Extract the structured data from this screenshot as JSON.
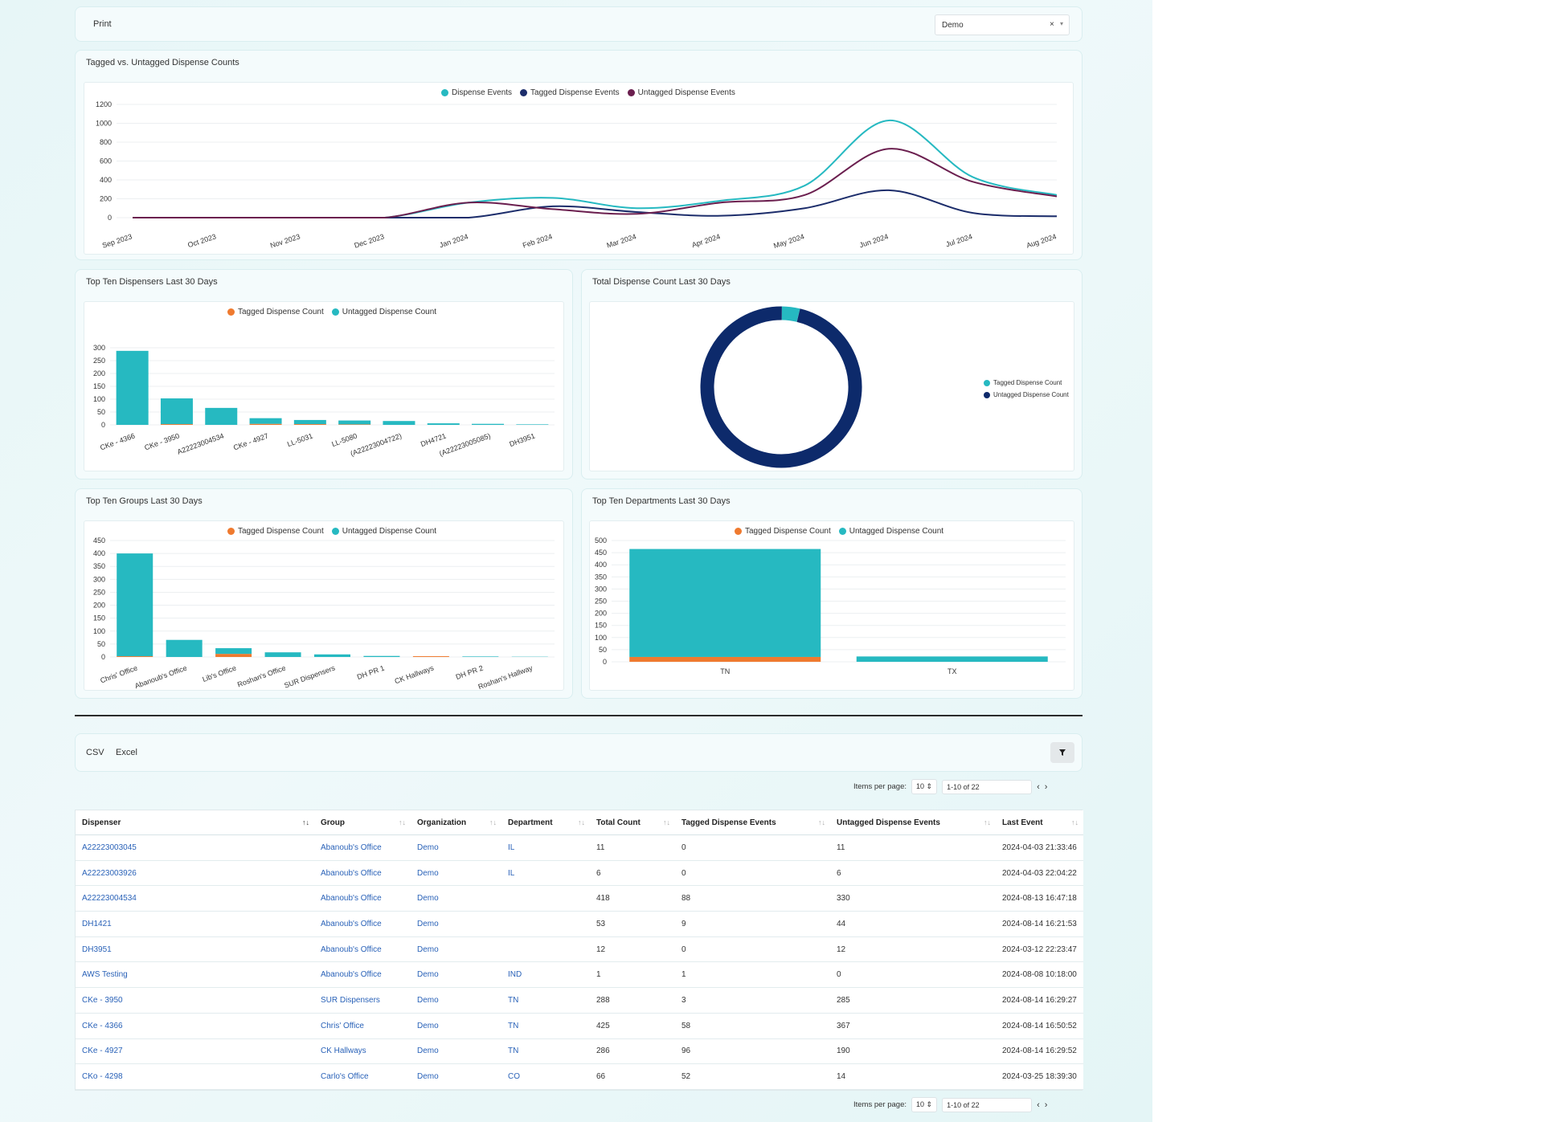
{
  "toolbar": {
    "print_label": "Print",
    "org_select_value": "Demo",
    "clear": "×",
    "caret": "▾"
  },
  "colors": {
    "teal": "#26b9c1",
    "navy": "#1c2d6b",
    "maroon": "#6b1f4f",
    "orange": "#ef7a2f",
    "donut_navy": "#0d2a6b"
  },
  "line_card": {
    "title": "Tagged vs. Untagged Dispense Counts",
    "legend": [
      "Dispense Events",
      "Tagged Dispense Events",
      "Untagged Dispense Events"
    ]
  },
  "dispensers_card": {
    "title": "Top Ten Dispensers Last 30 Days",
    "legend": [
      "Tagged Dispense Count",
      "Untagged Dispense Count"
    ]
  },
  "donut_card": {
    "title": "Total Dispense Count Last 30 Days",
    "legend": [
      "Tagged Dispense Count",
      "Untagged Dispense Count"
    ]
  },
  "groups_card": {
    "title": "Top Ten Groups Last 30 Days",
    "legend": [
      "Tagged Dispense Count",
      "Untagged Dispense Count"
    ]
  },
  "departments_card": {
    "title": "Top Ten Departments Last 30 Days",
    "legend": [
      "Tagged Dispense Count",
      "Untagged Dispense Count"
    ]
  },
  "chart_data": [
    {
      "type": "line",
      "title": "Tagged vs. Untagged Dispense Counts",
      "x": [
        "Sep 2023",
        "Oct 2023",
        "Nov 2023",
        "Dec 2023",
        "Jan 2024",
        "Feb 2024",
        "Mar 2024",
        "Apr 2024",
        "May 2024",
        "Jun 2024",
        "Jul 2024",
        "Aug 2024"
      ],
      "ylim": [
        0,
        1200
      ],
      "yticks": [
        0,
        200,
        400,
        600,
        800,
        1000,
        1200
      ],
      "legend_position": "top",
      "series": [
        {
          "name": "Dispense Events",
          "values": [
            0,
            0,
            0,
            0,
            160,
            210,
            100,
            180,
            340,
            1030,
            430,
            240
          ]
        },
        {
          "name": "Tagged Dispense Events",
          "values": [
            0,
            0,
            0,
            0,
            0,
            120,
            60,
            20,
            100,
            290,
            50,
            15
          ]
        },
        {
          "name": "Untagged Dispense Events",
          "values": [
            0,
            0,
            0,
            0,
            160,
            90,
            40,
            160,
            240,
            730,
            380,
            225
          ]
        }
      ]
    },
    {
      "type": "bar",
      "title": "Top Ten Dispensers Last 30 Days",
      "categories": [
        "CKe - 4366",
        "CKe - 3950",
        "A22223004534",
        "CKe - 4927",
        "LL-5031",
        "LL-5080",
        "(A22223004722)",
        "DH4721",
        "(A22223005085)",
        "DH3951"
      ],
      "ylim": [
        0,
        300
      ],
      "yticks": [
        0,
        50,
        100,
        150,
        200,
        250,
        300
      ],
      "legend_position": "top",
      "stacked": true,
      "series": [
        {
          "name": "Tagged Dispense Count",
          "values": [
            0,
            3,
            0,
            4,
            3,
            2,
            0,
            0,
            0,
            0
          ]
        },
        {
          "name": "Untagged Dispense Count",
          "values": [
            288,
            100,
            66,
            22,
            16,
            15,
            15,
            6,
            4,
            2
          ]
        }
      ]
    },
    {
      "type": "pie",
      "title": "Total Dispense Count Last 30 Days",
      "legend_position": "right",
      "series": [
        {
          "name": "Tagged Dispense Count",
          "values": [
            18
          ]
        },
        {
          "name": "Untagged Dispense Count",
          "values": [
            482
          ]
        }
      ]
    },
    {
      "type": "bar",
      "title": "Top Ten Groups Last 30 Days",
      "categories": [
        "Chris' Office",
        "Abanoub's Office",
        "Lib's Office",
        "Roshan's Office",
        "SUR Dispensers",
        "DH PR 1",
        "CK Hallways",
        "DH PR 2",
        "Roshan's Hallway"
      ],
      "ylim": [
        0,
        450
      ],
      "yticks": [
        0,
        50,
        100,
        150,
        200,
        250,
        300,
        350,
        400,
        450
      ],
      "legend_position": "top",
      "stacked": true,
      "series": [
        {
          "name": "Tagged Dispense Count",
          "values": [
            3,
            0,
            12,
            0,
            0,
            0,
            3,
            0,
            0
          ]
        },
        {
          "name": "Untagged Dispense Count",
          "values": [
            397,
            66,
            22,
            18,
            10,
            4,
            0,
            2,
            1
          ]
        }
      ]
    },
    {
      "type": "bar",
      "title": "Top Ten Departments Last 30 Days",
      "categories": [
        "TN",
        "TX"
      ],
      "ylim": [
        0,
        500
      ],
      "yticks": [
        0,
        50,
        100,
        150,
        200,
        250,
        300,
        350,
        400,
        450,
        500
      ],
      "legend_position": "top",
      "stacked": true,
      "series": [
        {
          "name": "Tagged Dispense Count",
          "values": [
            20,
            0
          ]
        },
        {
          "name": "Untagged Dispense Count",
          "values": [
            445,
            22
          ]
        }
      ]
    }
  ],
  "export": {
    "csv": "CSV",
    "excel": "Excel"
  },
  "pager": {
    "label": "Items per page:",
    "size": "10",
    "range": "1-10 of 22",
    "prev": "‹",
    "next": "›"
  },
  "table": {
    "columns": [
      "Dispenser",
      "Group",
      "Organization",
      "Department",
      "Total Count",
      "Tagged Dispense Events",
      "Untagged Dispense Events",
      "Last Event"
    ],
    "rows": [
      [
        "A22223003045",
        "Abanoub's Office",
        "Demo",
        "IL",
        "11",
        "0",
        "11",
        "2024-04-03 21:33:46"
      ],
      [
        "A22223003926",
        "Abanoub's Office",
        "Demo",
        "IL",
        "6",
        "0",
        "6",
        "2024-04-03 22:04:22"
      ],
      [
        "A22223004534",
        "Abanoub's Office",
        "Demo",
        "",
        "418",
        "88",
        "330",
        "2024-08-13 16:47:18"
      ],
      [
        "DH1421",
        "Abanoub's Office",
        "Demo",
        "",
        "53",
        "9",
        "44",
        "2024-08-14 16:21:53"
      ],
      [
        "DH3951",
        "Abanoub's Office",
        "Demo",
        "",
        "12",
        "0",
        "12",
        "2024-03-12 22:23:47"
      ],
      [
        "AWS Testing",
        "Abanoub's Office",
        "Demo",
        "IND",
        "1",
        "1",
        "0",
        "2024-08-08 10:18:00"
      ],
      [
        "CKe - 3950",
        "SUR Dispensers",
        "Demo",
        "TN",
        "288",
        "3",
        "285",
        "2024-08-14 16:29:27"
      ],
      [
        "CKe - 4366",
        "Chris' Office",
        "Demo",
        "TN",
        "425",
        "58",
        "367",
        "2024-08-14 16:50:52"
      ],
      [
        "CKe - 4927",
        "CK Hallways",
        "Demo",
        "TN",
        "286",
        "96",
        "190",
        "2024-08-14 16:29:52"
      ],
      [
        "CKo - 4298",
        "Carlo's Office",
        "Demo",
        "CO",
        "66",
        "52",
        "14",
        "2024-03-25 18:39:30"
      ]
    ]
  }
}
